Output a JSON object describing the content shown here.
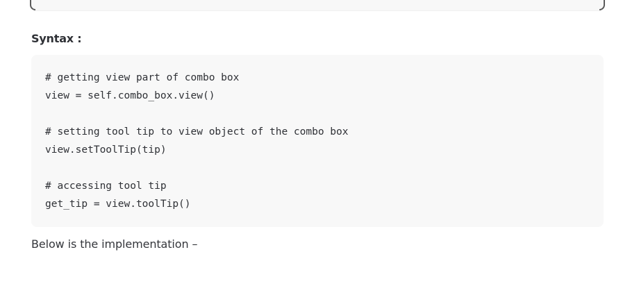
{
  "syntax": {
    "label": "Syntax :"
  },
  "code": {
    "lines": [
      "# getting view part of combo box",
      "view = self.combo_box.view()",
      "",
      "# setting tool tip to view object of the combo box",
      "view.setToolTip(tip)",
      "",
      "# accessing tool tip",
      "get_tip = view.toolTip()"
    ]
  },
  "body": {
    "implementation_text": "Below is the implementation –"
  }
}
